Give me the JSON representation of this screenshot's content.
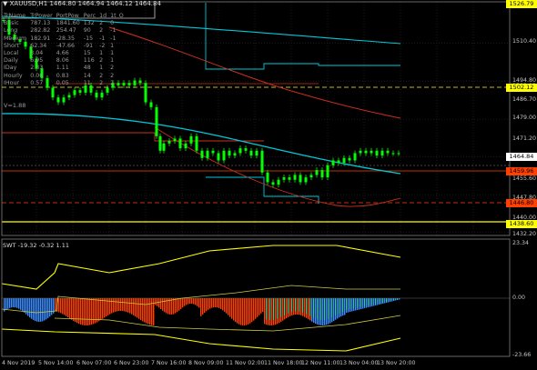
{
  "header": {
    "symbol_info": "XAUUSD,H1  1464.80 1464.94 1464.12 1464.84"
  },
  "stats_table": {
    "columns": [
      "TrName",
      "TrPower",
      "PortPow",
      "Perc",
      "1d",
      "1t_O"
    ],
    "rows": [
      [
        "Basic",
        "787.13",
        "1841.60",
        "132",
        "2",
        "0"
      ],
      [
        "Long",
        "282.82",
        "254.47",
        "90",
        "2",
        "-1"
      ],
      [
        "Medium",
        "182.91",
        "-28.35",
        "-15",
        "-1",
        "-1"
      ],
      [
        "Short",
        "62.34",
        "-47.66",
        "-91",
        "-2",
        "1"
      ],
      [
        "Local",
        "3.04",
        "4.66",
        "15",
        "1",
        "1"
      ],
      [
        "Daily",
        "6.95",
        "8.06",
        "116",
        "2",
        "1"
      ],
      [
        "IDay",
        "2.33",
        "1.11",
        "48",
        "1",
        "2"
      ],
      [
        "Hourly",
        "0.00",
        "0.83",
        "14",
        "2",
        "2"
      ],
      [
        "IHour",
        "0.57",
        "0.05",
        "11",
        "2",
        "2"
      ]
    ],
    "footer": "V=1.88"
  },
  "price_axis": [
    "1526.79",
    "1510.40",
    "1502.12",
    "1494.80",
    "1486.70",
    "1479.00",
    "1471.20",
    "1464.84",
    "1459.96",
    "1455.60",
    "1447.80",
    "1440.00",
    "1432.20"
  ],
  "price_tags": [
    {
      "text": "1526.79",
      "color": "#ffff00"
    },
    {
      "text": "1502.12",
      "color": "#ffff00"
    },
    {
      "text": "1464.84",
      "color": "#ffffff"
    },
    {
      "text": "1459.96",
      "color": "#ff4000"
    },
    {
      "text": "1446.80",
      "color": "#ff4000"
    },
    {
      "text": "1438.60",
      "color": "#ffff00"
    }
  ],
  "indicator": {
    "label": "SWT -19.32 -0.32 1.11",
    "axis": [
      "23.34",
      "0.00",
      "-23.66"
    ]
  },
  "time_axis": [
    "4 Nov 2019",
    "5 Nov 14:00",
    "6 Nov 07:00",
    "6 Nov 23:00",
    "7 Nov 16:00",
    "8 Nov 09:00",
    "11 Nov 02:00",
    "11 Nov 18:00",
    "12 Nov 11:00",
    "13 Nov 04:00",
    "13 Nov 20:00"
  ],
  "colors": {
    "background": "#000000",
    "candle": "#00ff00",
    "ma_cyan": "#00c8d8",
    "ma_red": "#c83020",
    "level_yellow": "#ffff00",
    "histo_red": "#ff4000",
    "histo_blue": "#3a8cff"
  }
}
